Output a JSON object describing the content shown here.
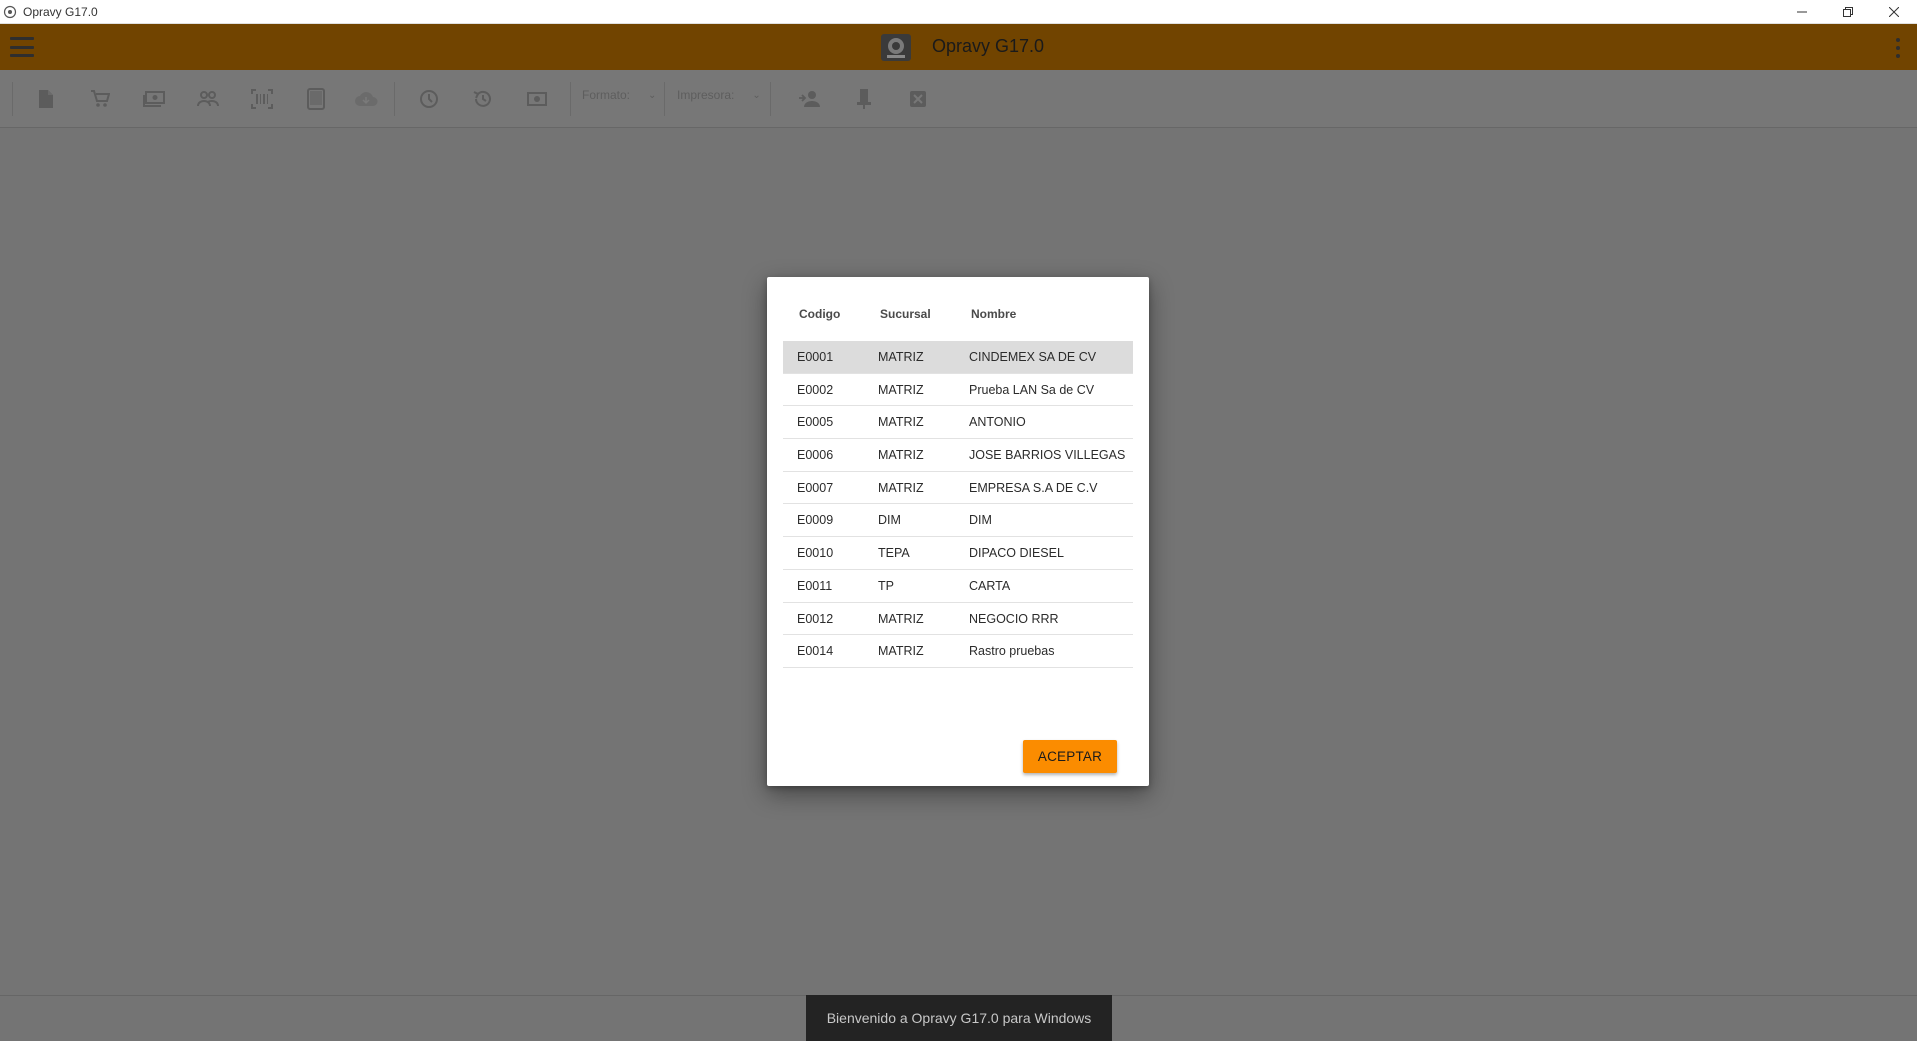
{
  "window": {
    "title": "Opravy G17.0",
    "controls": [
      "minimize-icon",
      "restore-icon",
      "close-icon"
    ]
  },
  "header": {
    "title": "Opravy G17.0",
    "bg_color": "#714400"
  },
  "toolbar": {
    "icons": [
      "document-icon",
      "cart-icon",
      "cash-icon",
      "people-icon",
      "barcode-scan-icon",
      "tablet-icon",
      "cloud-icon",
      "clock-icon",
      "history-icon",
      "money-icon",
      "person-switch-icon",
      "usb-icon",
      "close-box-icon"
    ],
    "formato_label": "Formato:",
    "impresora_label": "Impresora:"
  },
  "dialog": {
    "columns": [
      "Codigo",
      "Sucursal",
      "Nombre"
    ],
    "rows": [
      {
        "codigo": "E0001",
        "sucursal": "MATRIZ",
        "nombre": "CINDEMEX SA DE CV"
      },
      {
        "codigo": "E0002",
        "sucursal": "MATRIZ",
        "nombre": "Prueba LAN Sa de CV"
      },
      {
        "codigo": "E0005",
        "sucursal": "MATRIZ",
        "nombre": "ANTONIO"
      },
      {
        "codigo": "E0006",
        "sucursal": "MATRIZ",
        "nombre": "JOSE BARRIOS VILLEGAS"
      },
      {
        "codigo": "E0007",
        "sucursal": "MATRIZ",
        "nombre": "EMPRESA S.A DE C.V"
      },
      {
        "codigo": "E0009",
        "sucursal": "DIM",
        "nombre": "DIM"
      },
      {
        "codigo": "E0010",
        "sucursal": "TEPA",
        "nombre": "DIPACO DIESEL"
      },
      {
        "codigo": "E0011",
        "sucursal": "TP",
        "nombre": "CARTA"
      },
      {
        "codigo": "E0012",
        "sucursal": "MATRIZ",
        "nombre": "NEGOCIO RRR"
      },
      {
        "codigo": "E0014",
        "sucursal": "MATRIZ",
        "nombre": "Rastro pruebas"
      }
    ],
    "selected_row": 0,
    "accept_label": "ACEPTAR",
    "accept_color": "#fb8c00"
  },
  "snackbar": {
    "message": "Bienvenido a Opravy G17.0 para Windows"
  }
}
